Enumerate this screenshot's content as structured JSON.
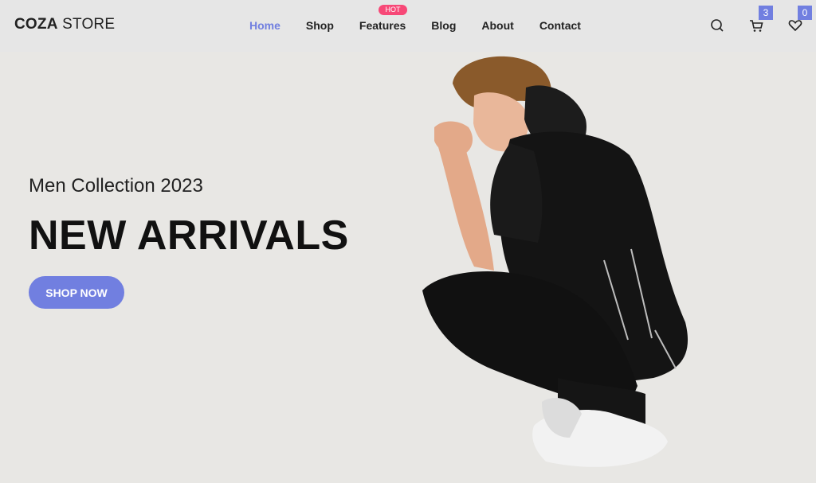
{
  "brand": {
    "part1": "COZA",
    "part2": " STORE"
  },
  "nav": {
    "items": [
      {
        "label": "Home"
      },
      {
        "label": "Shop"
      },
      {
        "label": "Features"
      },
      {
        "label": "Blog"
      },
      {
        "label": "About"
      },
      {
        "label": "Contact"
      }
    ],
    "hot_badge": "HOT"
  },
  "icons": {
    "search": "search-icon",
    "cart": "cart-icon",
    "wishlist": "heart-icon"
  },
  "counts": {
    "cart": "3",
    "wishlist": "0"
  },
  "hero": {
    "subtitle": "Men Collection 2023",
    "title": "NEW ARRIVALS",
    "cta": "SHOP NOW"
  },
  "colors": {
    "accent": "#717fe0",
    "hot": "#f74877",
    "background": "#e8e7e4"
  }
}
